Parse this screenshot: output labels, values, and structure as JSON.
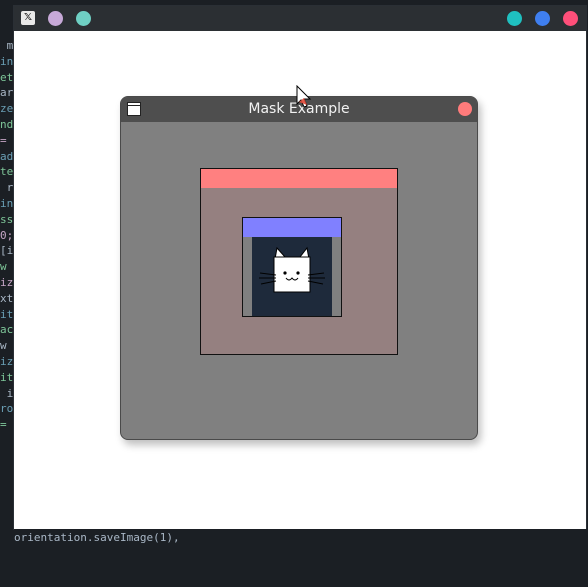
{
  "background_code": {
    "lines": [
      " m",
      "in",
      "et",
      "",
      "ar",
      "ze",
      "nd",
      "=",
      "",
      "ad",
      "te",
      "",
      " r",
      "in",
      "ss",
      "0;",
      "[i",
      "",
      "w",
      "iz",
      "xt",
      "it",
      "ac",
      "",
      "w",
      "iz",
      "it",
      "",
      " i",
      "ro",
      "="
    ]
  },
  "bottom_strip": {
    "text": "orientation.saveImage(1),"
  },
  "host_window": {
    "app_icon_glyph": "𝕏",
    "left_dots": [
      "#c7a9d8",
      "#6fd0c4"
    ],
    "right_dots": [
      "#1fc0c0",
      "#3f7ff0",
      "#ff4f7a"
    ],
    "right_dot_names": [
      "minimize",
      "maximize",
      "close"
    ]
  },
  "inner_window": {
    "title": "Mask Example",
    "close_color": "#ff7b7b",
    "background": "#808080"
  },
  "mask": {
    "outer_header_color": "#ff8080",
    "outer_body_color": "#958080",
    "inner_header_color": "#8080ff",
    "image_bg_color": "#1e2a3b"
  },
  "image": {
    "icon": "cat-face-icon"
  }
}
